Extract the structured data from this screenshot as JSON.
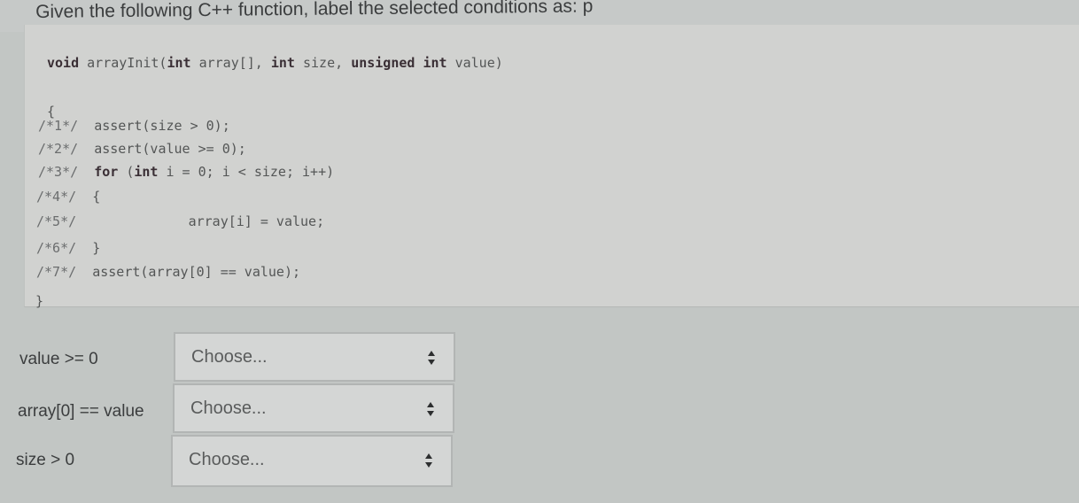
{
  "question": {
    "title": "Given the following C++ function, label the selected conditions as: p"
  },
  "code": {
    "signature": {
      "kw1": "void",
      "name": " arrayInit(",
      "kw2": "int",
      "p1": " array[], ",
      "kw3": "int",
      "p2": " size, ",
      "kw4": "unsigned int",
      "p3": " value)"
    },
    "open_brace": "{",
    "lines": [
      {
        "comment": "/*1*/",
        "code": "  assert(size > 0);"
      },
      {
        "comment": "/*2*/",
        "code": "  assert(value >= 0);"
      },
      {
        "comment": "/*3*/",
        "kw": "for",
        "kw2": "int",
        "code_a": " (",
        "code_b": " i = 0; i < size; i++)"
      },
      {
        "comment": "/*4*/",
        "code": "  {"
      },
      {
        "comment": "/*5*/",
        "code": "              array[i] = value;"
      },
      {
        "comment": "/*6*/",
        "code": "  }"
      },
      {
        "comment": "/*7*/",
        "code": "  assert(array[0] == value);"
      }
    ],
    "close_brace": "}"
  },
  "matches": [
    {
      "label": "value >= 0",
      "select_value": "Choose...",
      "icon": "updown-arrows-icon"
    },
    {
      "label": "array[0] == value",
      "select_value": "Choose...",
      "icon": "updown-arrows-icon"
    },
    {
      "label": "size > 0",
      "select_value": "Choose...",
      "icon": "updown-arrows-icon"
    }
  ],
  "colors": {
    "page_bg": "#c2c6c4",
    "code_bg": "#d1d2d0",
    "keyword": "#3a2f35"
  }
}
